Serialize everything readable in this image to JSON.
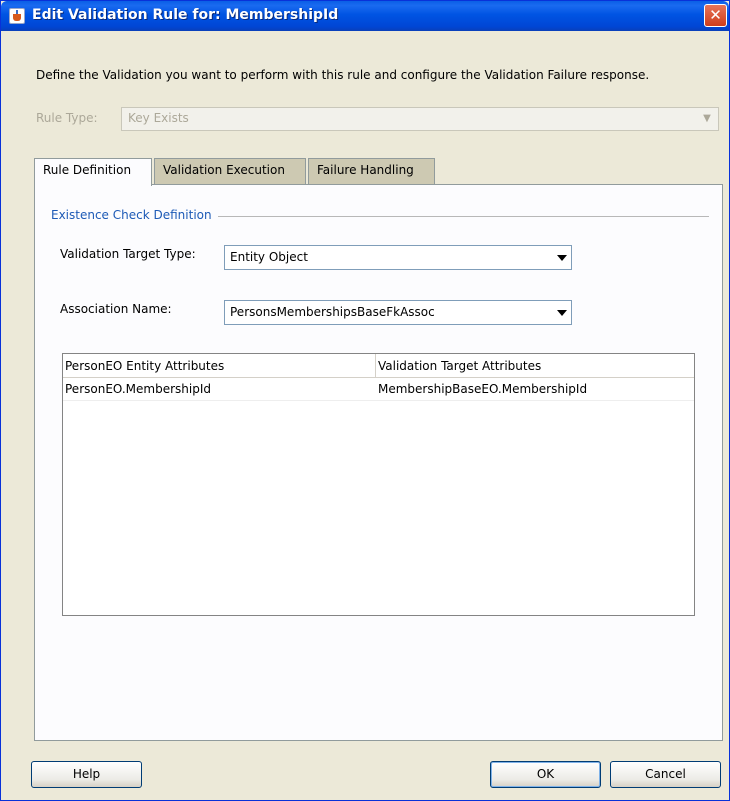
{
  "window": {
    "title": "Edit Validation Rule for: MembershipId",
    "close_glyph": "✕"
  },
  "description": "Define the Validation you want to perform with this rule and configure the Validation Failure response.",
  "rule_type": {
    "label": "Rule Type:",
    "value": "Key Exists",
    "arrow_glyph": "▼"
  },
  "tabs": [
    {
      "label": "Rule Definition",
      "selected": true
    },
    {
      "label": "Validation Execution",
      "selected": false
    },
    {
      "label": "Failure Handling",
      "selected": false
    }
  ],
  "existence_check": {
    "group_title": "Existence Check Definition",
    "target_type_label": "Validation Target Type:",
    "target_type_value": "Entity Object",
    "association_label": "Association Name:",
    "association_value": "PersonsMembershipsBaseFkAssoc"
  },
  "attributes_table": {
    "columns": [
      "PersonEO Entity Attributes",
      "Validation Target Attributes"
    ],
    "rows": [
      [
        "PersonEO.MembershipId",
        "MembershipBaseEO.MembershipId"
      ]
    ]
  },
  "buttons": {
    "help": "Help",
    "ok": "OK",
    "cancel": "Cancel"
  },
  "colors": {
    "title_bar": "#0054e3",
    "dialog_bg": "#ece9d8",
    "group_title": "#1d5ab6",
    "close_button": "#cf3d1a"
  },
  "icons": {
    "window": "java-cup-icon",
    "close": "close-icon",
    "dropdown": "chevron-down-icon"
  }
}
